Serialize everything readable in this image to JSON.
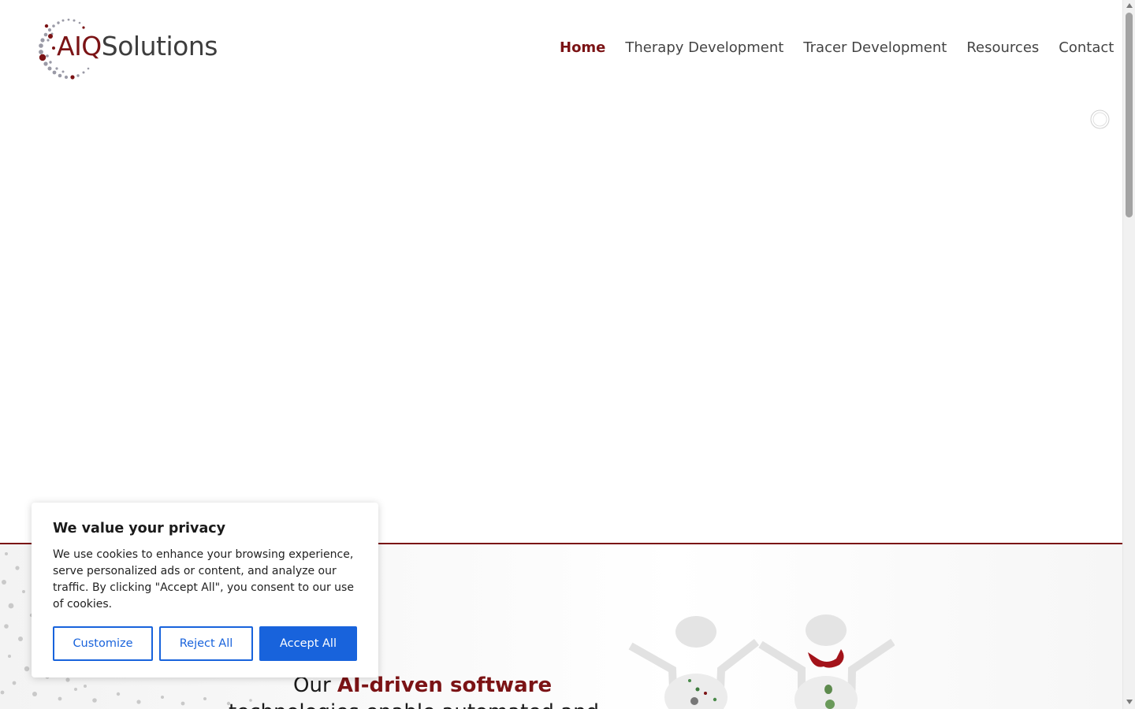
{
  "brand": {
    "name_part1": "AIQ",
    "name_part2": "Solutions",
    "accent_color": "#7b1315",
    "text_color": "#3d3d3d"
  },
  "nav": {
    "items": [
      {
        "label": "Home",
        "active": true
      },
      {
        "label": "Therapy Development",
        "active": false
      },
      {
        "label": "Tracer Development",
        "active": false
      },
      {
        "label": "Resources",
        "active": false
      },
      {
        "label": "Contact",
        "active": false
      }
    ]
  },
  "hero": {
    "tagline_prefix": "Our ",
    "tagline_highlight": "AI-driven software",
    "tagline_line2": "technologies enable automated and"
  },
  "cookie_banner": {
    "title": "We value your privacy",
    "body": "We use cookies to enhance your browsing experience, serve personalized ads or content, and analyze our traffic. By clicking \"Accept All\", you consent to our use of cookies.",
    "customize_label": "Customize",
    "reject_label": "Reject All",
    "accept_label": "Accept All",
    "button_color": "#1863dc"
  },
  "icons": {
    "loader": "spinner-icon",
    "scan": "pet-scan-image"
  }
}
